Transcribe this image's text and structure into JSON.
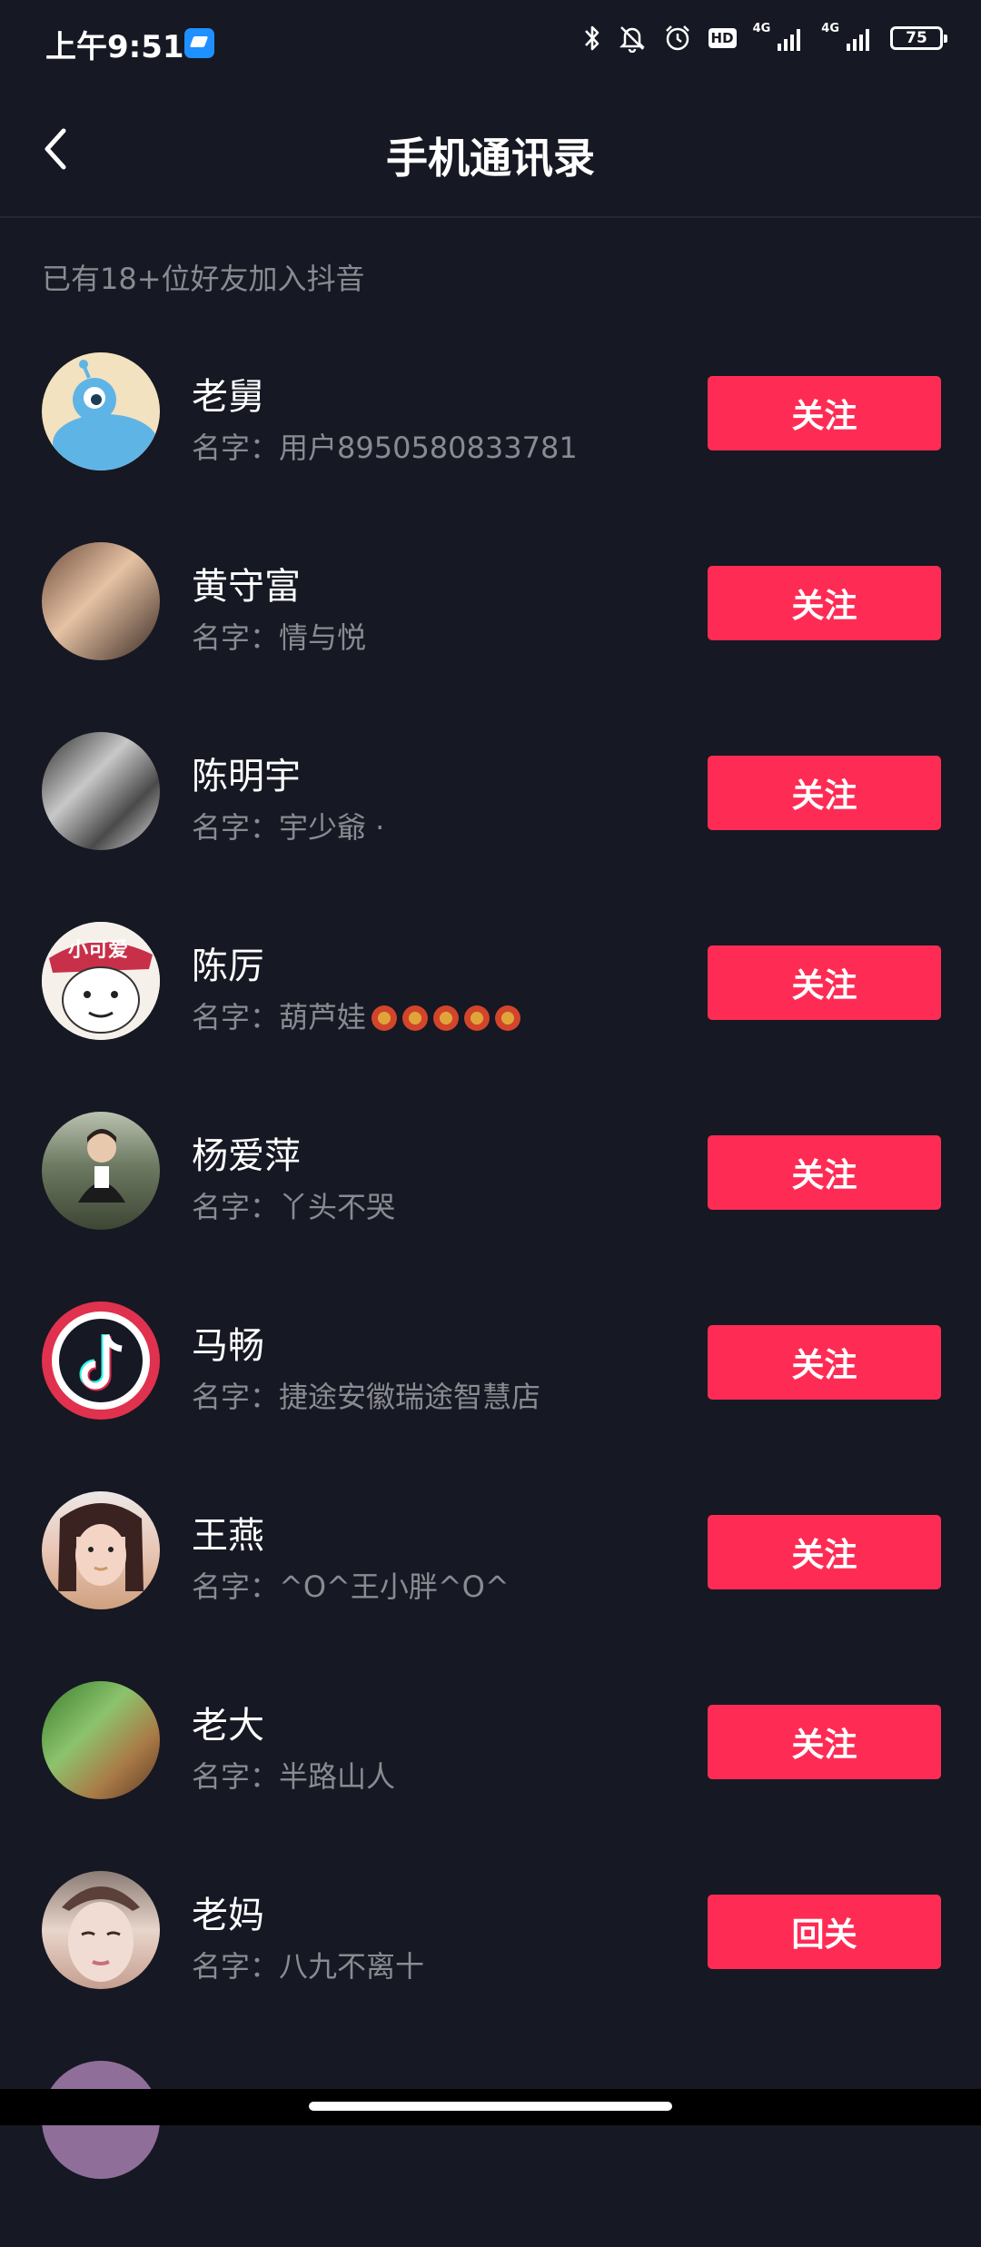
{
  "status_bar": {
    "time": "上午9:51",
    "hd_label": "HD",
    "net1": "4G",
    "net2": "4G",
    "battery": "75"
  },
  "nav": {
    "title": "手机通讯录"
  },
  "hint": "已有18+位好友加入抖音",
  "contacts": [
    {
      "name": "老舅",
      "nickname": "名字：用户8950580833781",
      "action": "关注"
    },
    {
      "name": "黄守富",
      "nickname": "名字：情与悦",
      "action": "关注"
    },
    {
      "name": "陈明宇",
      "nickname": "名字：宇少爺 ·",
      "action": "关注"
    },
    {
      "name": "陈厉",
      "nickname": "名字：葫芦娃",
      "action": "关注"
    },
    {
      "name": "杨爱萍",
      "nickname": "名字：丫头不哭",
      "action": "关注"
    },
    {
      "name": "马畅",
      "nickname": "名字：捷途安徽瑞途智慧店",
      "action": "关注"
    },
    {
      "name": "王燕",
      "nickname": "名字：^O^王小胖^O^",
      "action": "关注"
    },
    {
      "name": "老大",
      "nickname": "名字：半路山人",
      "action": "关注"
    },
    {
      "name": "老妈",
      "nickname": "名字：八九不离十",
      "action": "回关"
    }
  ],
  "avatar4_text": "小可爱",
  "colors": {
    "background": "#161823",
    "accent": "#fe2c55",
    "secondary_text": "#8a8b91"
  }
}
